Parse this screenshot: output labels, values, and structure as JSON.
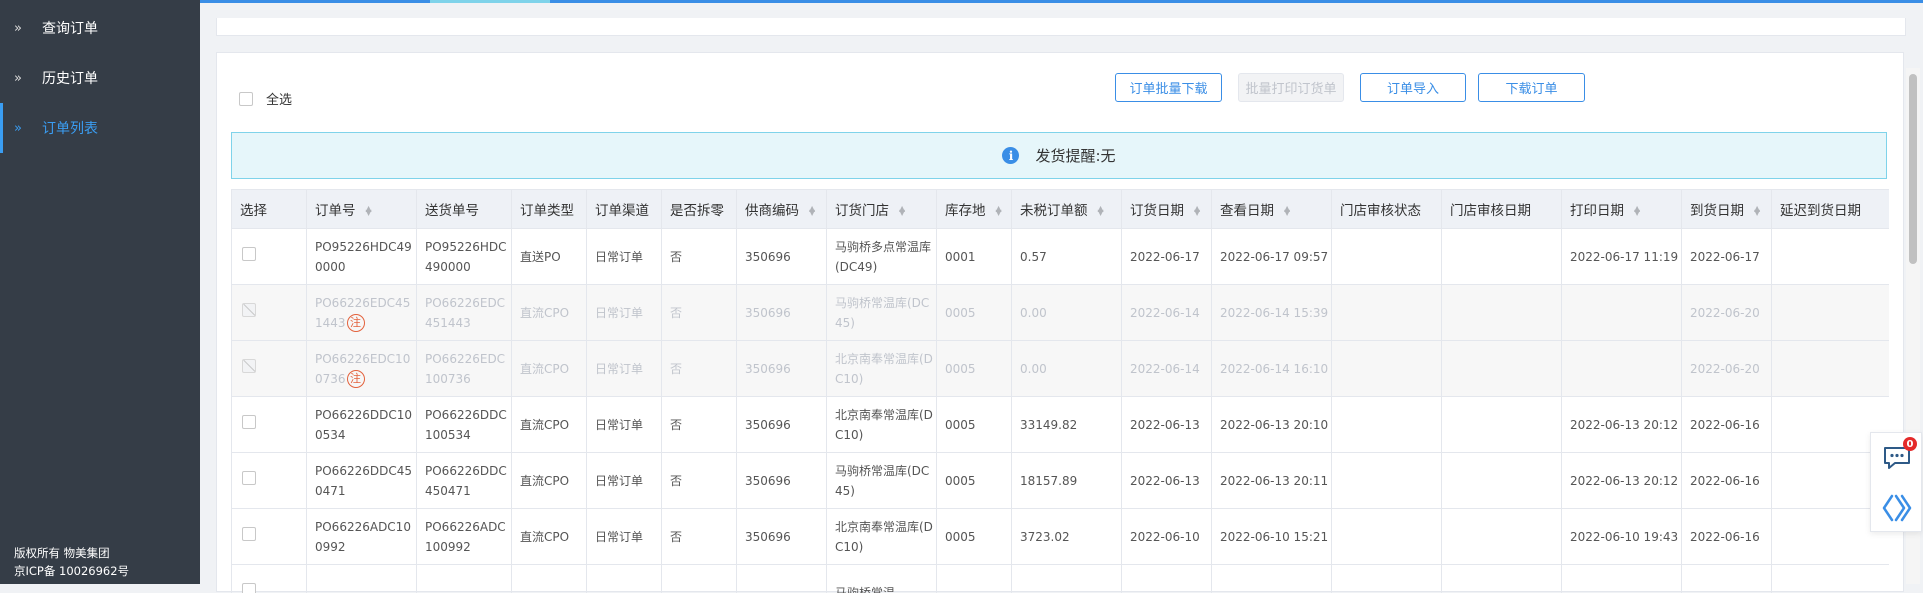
{
  "sidebar": {
    "items": [
      {
        "label": "查询订单",
        "active": false
      },
      {
        "label": "历史订单",
        "active": false
      },
      {
        "label": "订单列表",
        "active": true
      }
    ],
    "footer": {
      "copyright": "版权所有 物美集团",
      "icp": "京ICP备 10026962号"
    }
  },
  "toolbar": {
    "select_all_label": "全选",
    "buttons": [
      {
        "label": "订单批量下载",
        "disabled": false
      },
      {
        "label": "批量打印订货单",
        "disabled": true
      },
      {
        "label": "订单导入",
        "disabled": false
      },
      {
        "label": "下载订单",
        "disabled": false
      }
    ]
  },
  "notice": {
    "text": "发货提醒:无",
    "icon": "info-icon"
  },
  "table": {
    "columns": [
      "选择",
      "订单号",
      "送货单号",
      "订单类型",
      "订单渠道",
      "是否拆零",
      "供商编码",
      "订货门店",
      "库存地",
      "未税订单额",
      "订货日期",
      "查看日期",
      "门店审核状态",
      "门店审核日期",
      "打印日期",
      "到货日期",
      "延迟到货日期"
    ],
    "rows": [
      {
        "dim": false,
        "flag": "",
        "cells": [
          "PO95226HDC490000",
          "PO95226HDC490000",
          "直送PO",
          "日常订单",
          "否",
          "350696",
          "马驹桥多点常温库(DC49)",
          "0001",
          "0.57",
          "2022-06-17",
          "2022-06-17 09:57",
          "",
          "",
          "2022-06-17 11:19",
          "2022-06-17",
          ""
        ]
      },
      {
        "dim": true,
        "flag": "注",
        "cells": [
          "PO66226EDC451443",
          "PO66226EDC451443",
          "直流CPO",
          "日常订单",
          "否",
          "350696",
          "马驹桥常温库(DC45)",
          "0005",
          "0.00",
          "2022-06-14",
          "2022-06-14 15:39",
          "",
          "",
          "",
          "2022-06-20",
          ""
        ]
      },
      {
        "dim": true,
        "flag": "注",
        "cells": [
          "PO66226EDC100736",
          "PO66226EDC100736",
          "直流CPO",
          "日常订单",
          "否",
          "350696",
          "北京南奉常温库(DC10)",
          "0005",
          "0.00",
          "2022-06-14",
          "2022-06-14 16:10",
          "",
          "",
          "",
          "2022-06-20",
          ""
        ]
      },
      {
        "dim": false,
        "flag": "",
        "cells": [
          "PO66226DDC100534",
          "PO66226DDC100534",
          "直流CPO",
          "日常订单",
          "否",
          "350696",
          "北京南奉常温库(DC10)",
          "0005",
          "33149.82",
          "2022-06-13",
          "2022-06-13 20:10",
          "",
          "",
          "2022-06-13 20:12",
          "2022-06-16",
          ""
        ]
      },
      {
        "dim": false,
        "flag": "",
        "cells": [
          "PO66226DDC450471",
          "PO66226DDC450471",
          "直流CPO",
          "日常订单",
          "否",
          "350696",
          "马驹桥常温库(DC45)",
          "0005",
          "18157.89",
          "2022-06-13",
          "2022-06-13 20:11",
          "",
          "",
          "2022-06-13 20:12",
          "2022-06-16",
          ""
        ]
      },
      {
        "dim": false,
        "flag": "",
        "cells": [
          "PO66226ADC100992",
          "PO66226ADC100992",
          "直流CPO",
          "日常订单",
          "否",
          "350696",
          "北京南奉常温库(DC10)",
          "0005",
          "3723.02",
          "2022-06-10",
          "2022-06-10 15:21",
          "",
          "",
          "2022-06-10 19:43",
          "2022-06-16",
          ""
        ]
      },
      {
        "dim": false,
        "flag": "",
        "cells": [
          "",
          "",
          "",
          "",
          "",
          "",
          "马驹桥常温",
          "",
          "",
          "",
          "",
          "",
          "",
          "",
          "",
          ""
        ]
      }
    ]
  },
  "float_panel": {
    "chat_badge": "0",
    "chat_icon": "chat-icon",
    "collapse_icon": "double-chevron-icon"
  },
  "colors": {
    "accent": "#3a8ee6",
    "sidebar": "#353d47",
    "active": "#3a9df2",
    "notice_bg": "#e6f6fa",
    "flag": "#e3623d"
  }
}
